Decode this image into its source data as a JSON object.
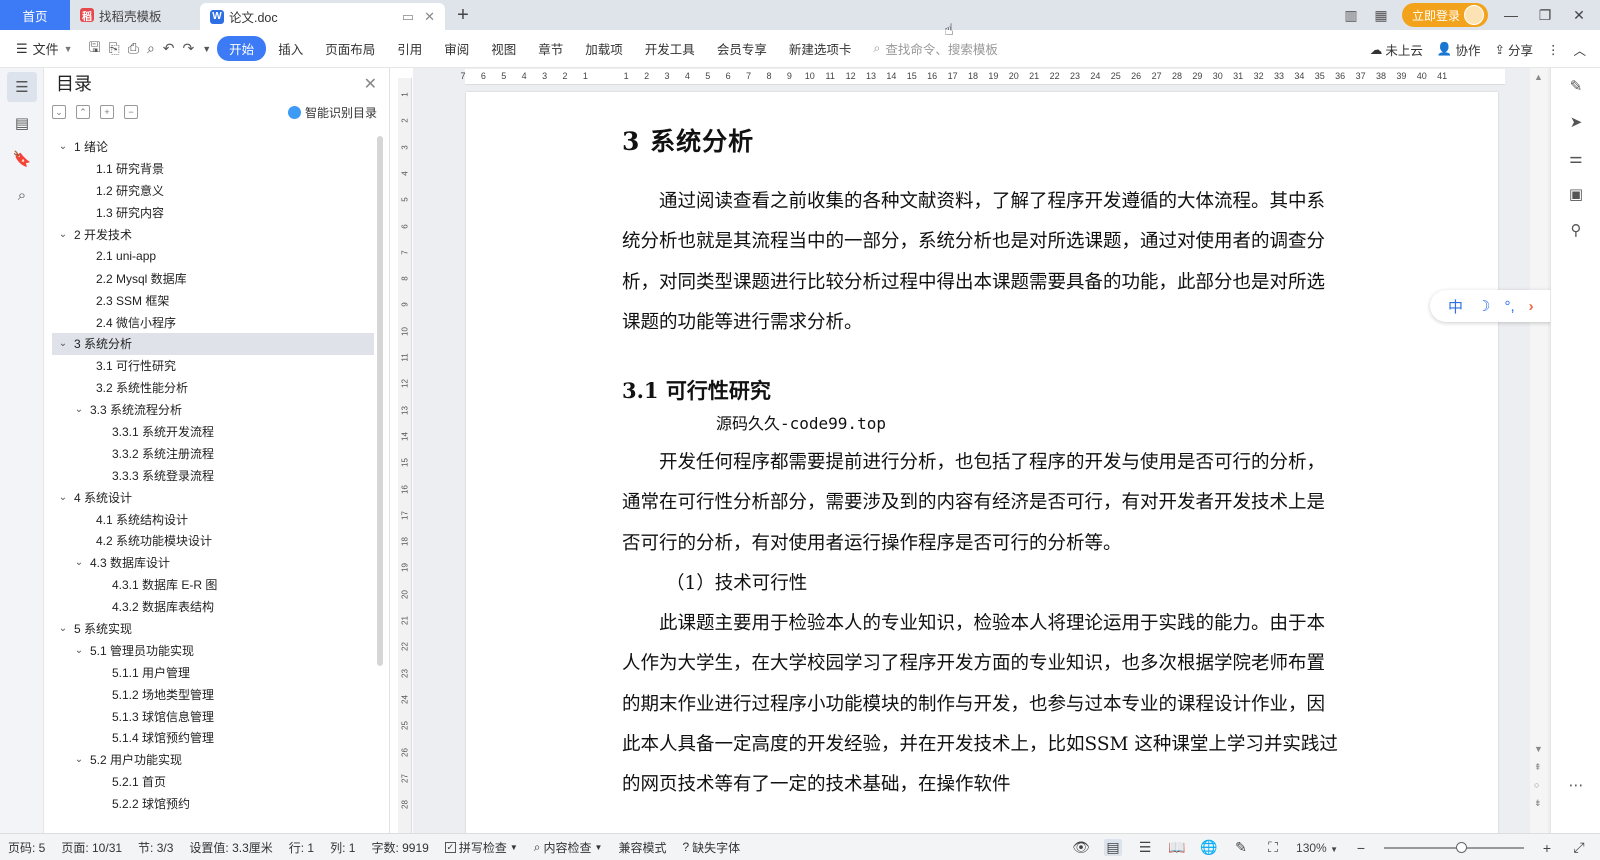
{
  "tabs": {
    "home": "首页",
    "templates": "找稻壳模板",
    "doc": "论文.doc",
    "new": "+"
  },
  "topbar": {
    "login": "立即登录"
  },
  "ribbon": {
    "file": "文件",
    "menu": [
      "开始",
      "插入",
      "页面布局",
      "引用",
      "审阅",
      "视图",
      "章节",
      "加载项",
      "开发工具",
      "会员专享",
      "新建选项卡"
    ],
    "search_placeholder": "查找命令、搜索模板",
    "cloud": "未上云",
    "collab": "协作",
    "share": "分享"
  },
  "toc": {
    "title": "目录",
    "smart": "智能识别目录",
    "items": [
      {
        "text": "1  绪论",
        "level": 1,
        "expand": true
      },
      {
        "text": "1.1  研究背景",
        "level": 2
      },
      {
        "text": "1.2  研究意义",
        "level": 2
      },
      {
        "text": "1.3  研究内容",
        "level": 2
      },
      {
        "text": "2  开发技术",
        "level": 1,
        "expand": true
      },
      {
        "text": "2.1 uni-app",
        "level": 2
      },
      {
        "text": "2.2 Mysql 数据库",
        "level": 2
      },
      {
        "text": "2.3 SSM 框架",
        "level": 2
      },
      {
        "text": "2.4  微信小程序",
        "level": 2
      },
      {
        "text": "3  系统分析",
        "level": 1,
        "expand": true,
        "selected": true
      },
      {
        "text": "3.1 可行性研究",
        "level": 2
      },
      {
        "text": "3.2 系统性能分析",
        "level": 2
      },
      {
        "text": "3.3  系统流程分析",
        "level": 2,
        "expand": true
      },
      {
        "text": "3.3.1  系统开发流程",
        "level": 3
      },
      {
        "text": "3.3.2  系统注册流程",
        "level": 3
      },
      {
        "text": "3.3.3  系统登录流程",
        "level": 3
      },
      {
        "text": "4  系统设计",
        "level": 1,
        "expand": true
      },
      {
        "text": "4.1  系统结构设计",
        "level": 2
      },
      {
        "text": "4.2 系统功能模块设计",
        "level": 2
      },
      {
        "text": "4.3 数据库设计",
        "level": 2,
        "expand": true
      },
      {
        "text": "4.3.1 数据库 E-R 图",
        "level": 3
      },
      {
        "text": "4.3.2  数据库表结构",
        "level": 3
      },
      {
        "text": "5  系统实现",
        "level": 1,
        "expand": true
      },
      {
        "text": "5.1  管理员功能实现",
        "level": 2,
        "expand": true
      },
      {
        "text": "5.1.1  用户管理",
        "level": 3
      },
      {
        "text": "5.1.2  场地类型管理",
        "level": 3
      },
      {
        "text": "5.1.3  球馆信息管理",
        "level": 3
      },
      {
        "text": "5.1.4  球馆预约管理",
        "level": 3
      },
      {
        "text": "5.2  用户功能实现",
        "level": 2,
        "expand": true
      },
      {
        "text": "5.2.1  首页",
        "level": 3
      },
      {
        "text": "5.2.2  球馆预约",
        "level": 3
      }
    ]
  },
  "document": {
    "heading": "3  系统分析",
    "intro": "通过阅读查看之前收集的各种文献资料，了解了程序开发遵循的大体流程。其中系统分析也就是其流程当中的一部分，系统分析也是对所选课题，通过对使用者的调查分析，对同类型课题进行比较分析过程中得出本课题需要具备的功能，此部分也是对所选课题的功能等进行需求分析。",
    "section": "3.1 可行性研究",
    "watermark_line": "源码久久-code99.top",
    "para1": "开发任何程序都需要提前进行分析，也包括了程序的开发与使用是否可行的分析，通常在可行性分析部分，需要涉及到的内容有经济是否可行，有对开发者开发技术上是否可行的分析，有对使用者运行操作程序是否可行的分析等。",
    "subhead": "（1）技术可行性",
    "para2": "此课题主要用于检验本人的专业知识，检验本人将理论运用于实践的能力。由于本人作为大学生，在大学校园学习了程序开发方面的专业知识，也多次根据学院老师布置的期末作业进行过程序小功能模块的制作与开发，也参与过本专业的课程设计作业，因此本人具备一定高度的开发经验，并在开发技术上，比如SSM 这种课堂上学习并实践过的网页技术等有了一定的技术基础，在操作软件"
  },
  "ime": {
    "lang": "中",
    "moon": "☽",
    "punct": "°,"
  },
  "status": {
    "page": "页码: 5",
    "pages": "页面: 10/31",
    "section": "节: 3/3",
    "setting": "设置值: 3.3厘米",
    "row": "行: 1",
    "col": "列: 1",
    "words": "字数: 9919",
    "spell": "拼写检查",
    "content": "内容检查",
    "compat": "兼容模式",
    "missing_font": "缺失字体",
    "zoom": "130%",
    "zoom_level": 0.55
  },
  "rulers": {
    "horizontal": [
      "7",
      "6",
      "5",
      "4",
      "3",
      "2",
      "1",
      "",
      "1",
      "2",
      "3",
      "4",
      "5",
      "6",
      "7",
      "8",
      "9",
      "10",
      "11",
      "12",
      "13",
      "14",
      "15",
      "16",
      "17",
      "18",
      "19",
      "20",
      "21",
      "22",
      "23",
      "24",
      "25",
      "26",
      "27",
      "28",
      "29",
      "30",
      "31",
      "32",
      "33",
      "34",
      "35",
      "36",
      "37",
      "38",
      "39",
      "40",
      "41"
    ],
    "vertical": [
      "1",
      "2",
      "3",
      "4",
      "5",
      "6",
      "7",
      "8",
      "9",
      "10",
      "11",
      "12",
      "13",
      "14",
      "15",
      "16",
      "17",
      "18",
      "19",
      "20",
      "21",
      "22",
      "23",
      "24",
      "25",
      "26",
      "27",
      "28"
    ]
  }
}
